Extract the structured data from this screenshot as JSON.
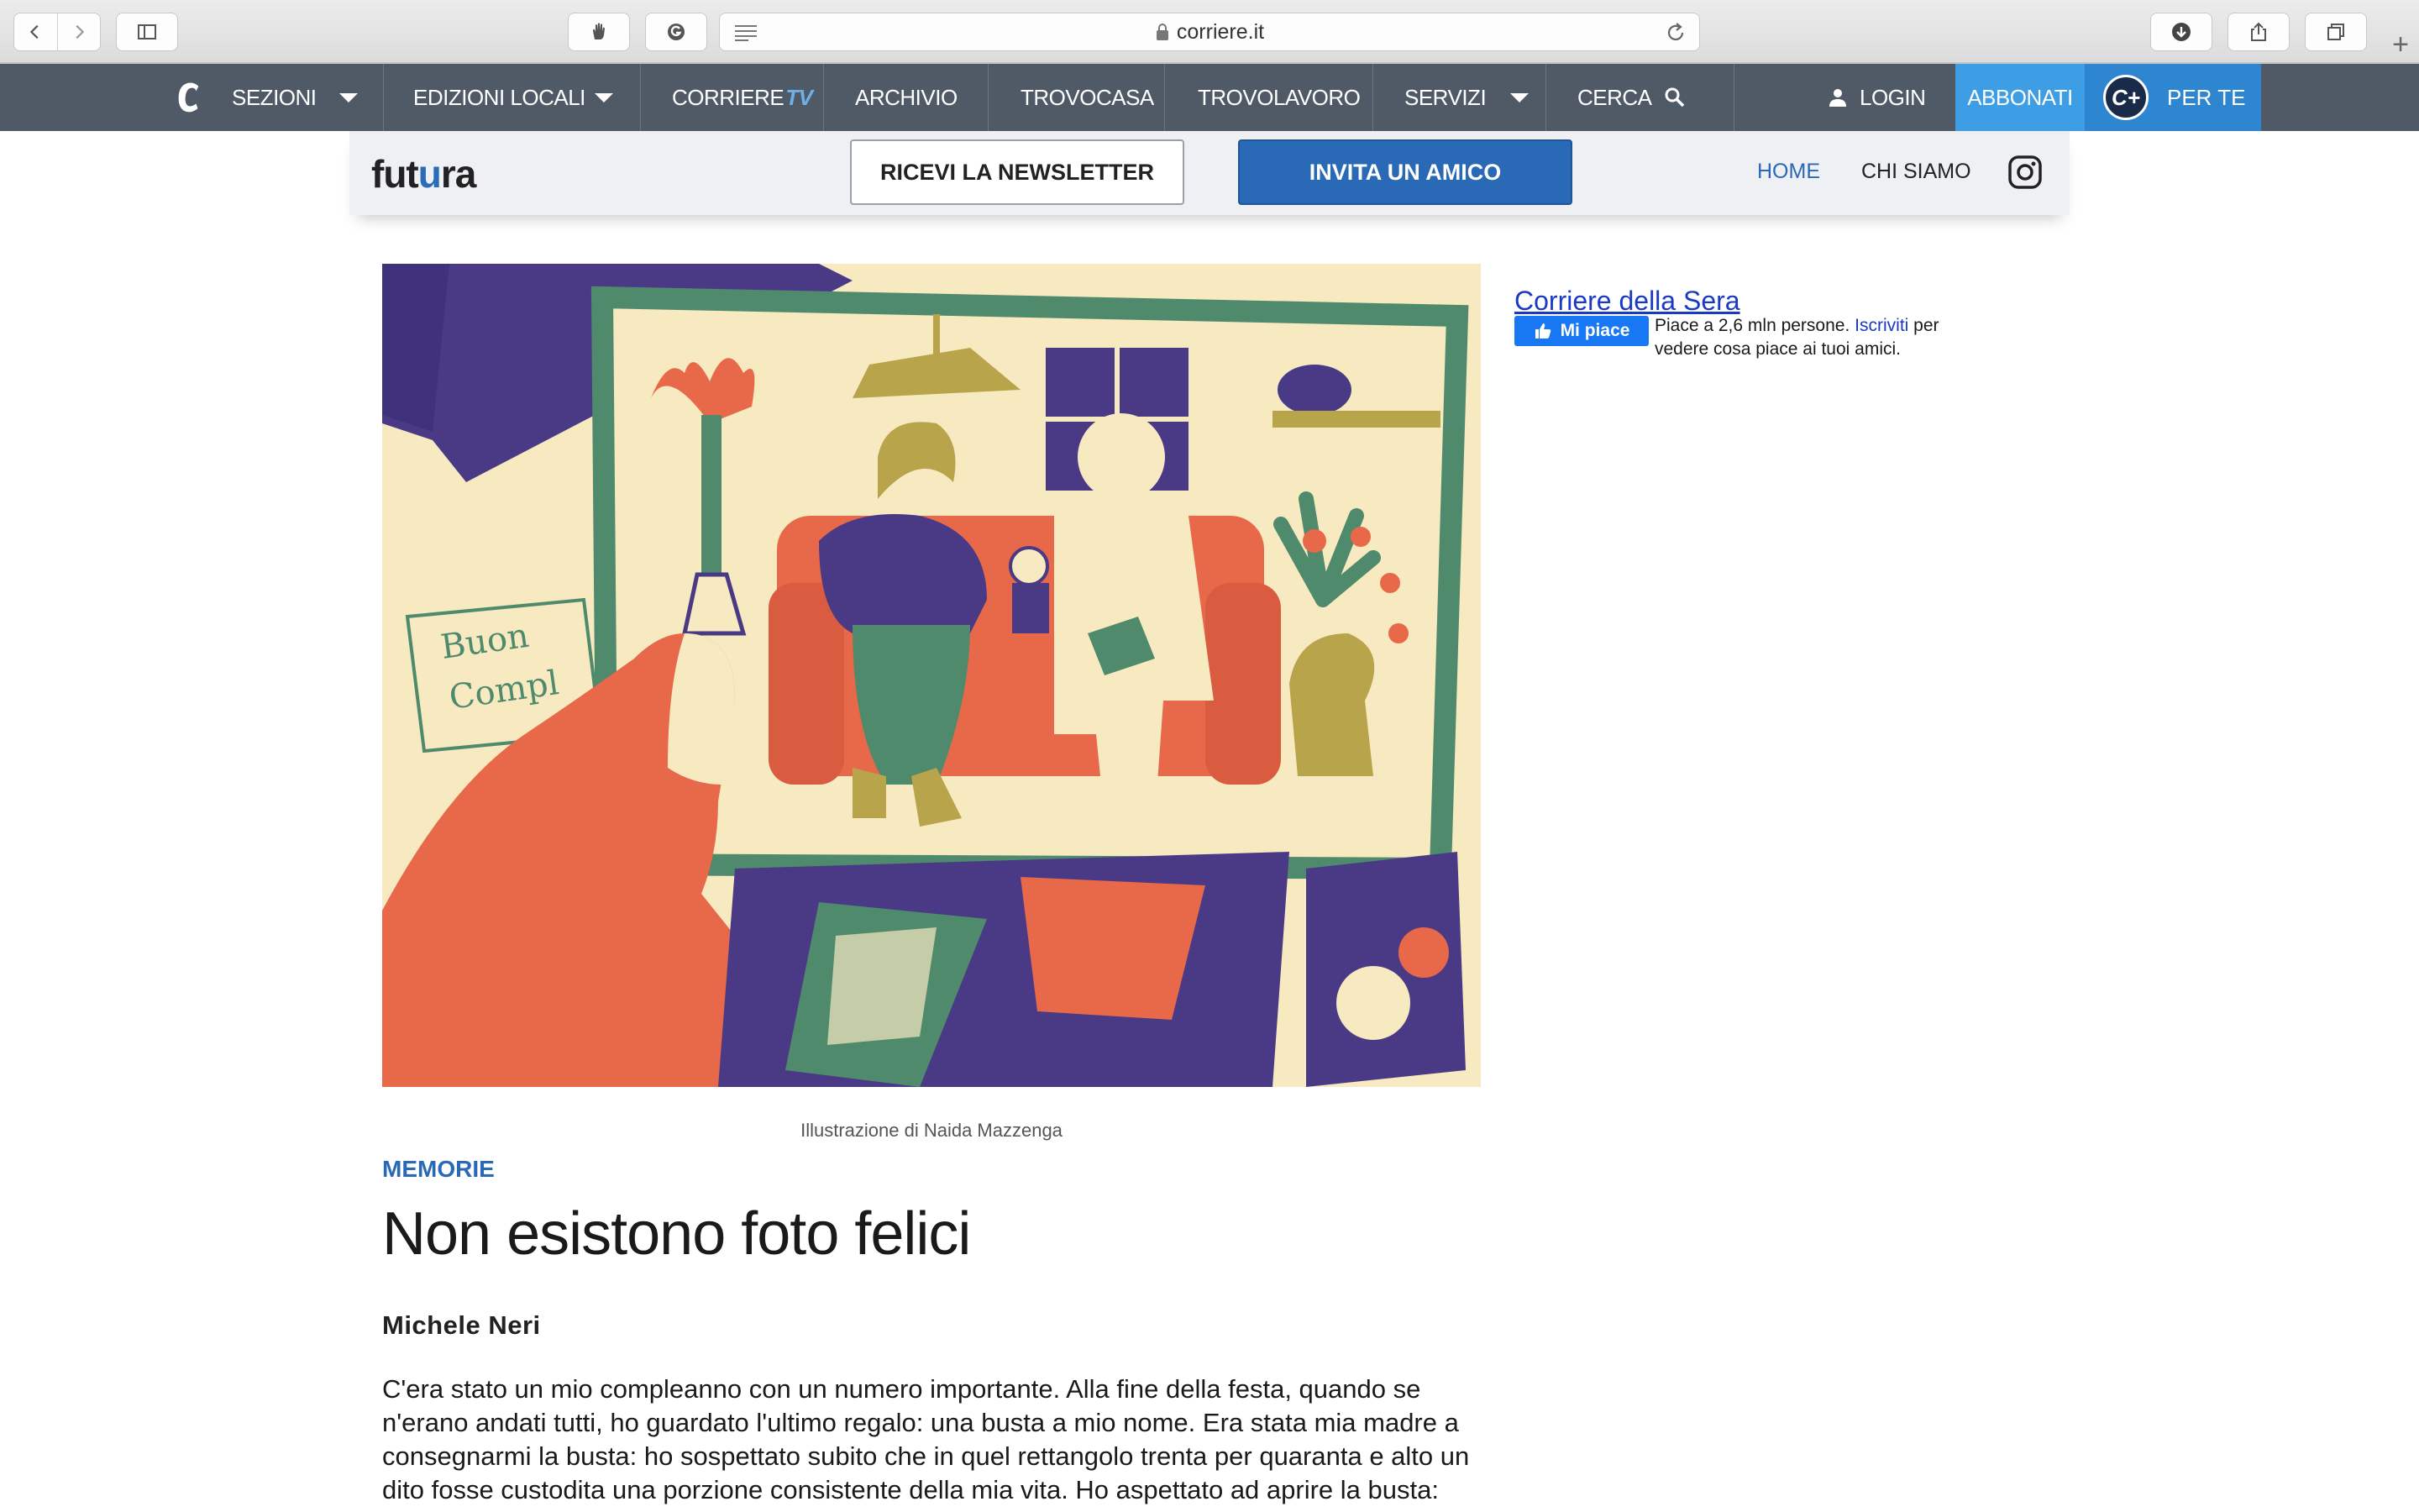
{
  "browser": {
    "url": "corriere.it"
  },
  "mainnav": {
    "sezioni": "SEZIONI",
    "edizioni_locali": "EDIZIONI LOCALI",
    "corriere_tv_a": "CORRIERE",
    "corriere_tv_b": "TV",
    "archivio": "ARCHIVIO",
    "trovocasa": "TROVOCASA",
    "trovolavoro": "TROVOLAVORO",
    "servizi": "SERVIZI",
    "cerca": "CERCA",
    "login": "LOGIN",
    "abbonati": "ABBONATI",
    "cplus": "C+",
    "per_te": "PER TE"
  },
  "subheader": {
    "logo_a": "fut",
    "logo_b": "u",
    "logo_c": "ra",
    "newsletter": "RICEVI LA NEWSLETTER",
    "invite": "INVITA UN AMICO",
    "home": "HOME",
    "chi_siamo": "CHI SIAMO"
  },
  "article": {
    "caption": "Illustrazione di Naida Mazzenga",
    "kicker": "MEMORIE",
    "title": "Non esistono foto felici",
    "author": "Michele Neri",
    "body": "C'era stato un mio compleanno con un numero importante. Alla fine della festa, quando se n'erano andati tutti, ho guardato l'ultimo regalo: una busta a mio nome. Era stata mia madre a consegnarmi la busta: ho sospettato subito che in quel rettangolo trenta per quaranta e alto un dito fosse custodita una porzione consistente della mia vita. Ho aspettato ad aprire la busta:",
    "card_text_1": "Buon",
    "card_text_2": "Compl"
  },
  "facebook": {
    "page_name": "Corriere della Sera",
    "like_label": "Mi piace",
    "likes_text": "Piace a 2,6 mln persone.",
    "signup": "Iscriviti",
    "after_signup": "per vedere cosa piace ai tuoi amici."
  },
  "colors": {
    "nav_bg": "#505a66",
    "accent_blue": "#2a69b5",
    "abbonati_bg": "#3d9ee6",
    "illustration_cream": "#f7e9c0",
    "illustration_orange": "#e8684a",
    "illustration_green": "#4f8a6c",
    "illustration_purple": "#4a3a86",
    "illustration_olive": "#b8a44a"
  }
}
